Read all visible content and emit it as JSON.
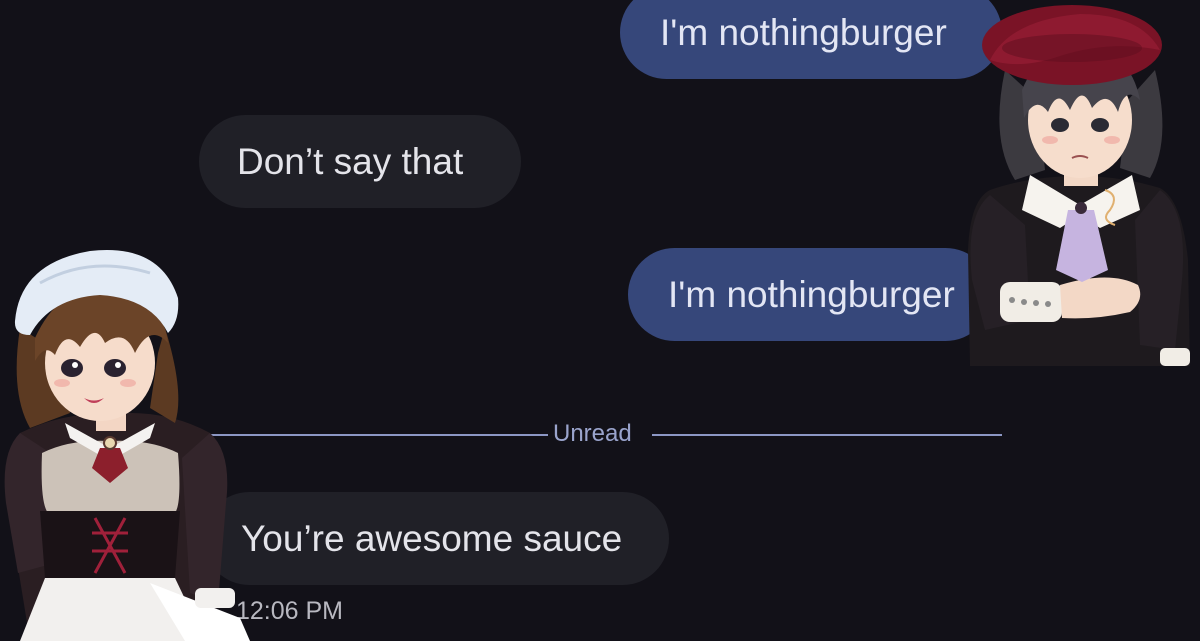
{
  "messages": [
    {
      "direction": "outgoing",
      "text": "I'm nothingburger"
    },
    {
      "direction": "incoming",
      "text": "Don’t say that"
    },
    {
      "direction": "outgoing",
      "text": "I'm nothingburger"
    },
    {
      "direction": "incoming",
      "text": "You’re awesome sauce"
    }
  ],
  "divider": {
    "label": "Unread"
  },
  "last_message_time": "12:06 PM",
  "stickers": [
    {
      "name": "maid-character-sticker"
    },
    {
      "name": "beret-character-sticker"
    }
  ],
  "colors": {
    "background": "#121118",
    "outgoing_bubble": "#36477a",
    "incoming_bubble": "#202027",
    "divider": "#8c97c4"
  }
}
